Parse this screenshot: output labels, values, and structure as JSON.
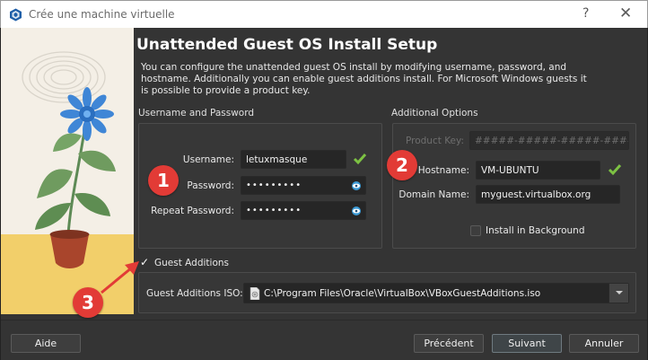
{
  "window": {
    "title": "Crée une machine virtuelle",
    "help": "?",
    "close": "✕"
  },
  "page": {
    "heading": "Unattended Guest OS Install Setup",
    "description": "You can configure the unattended guest OS install by modifying username, password, and hostname. Additionally you can enable guest additions install. For Microsoft Windows guests it is possible to provide a product key."
  },
  "user_section": {
    "title": "Username and Password",
    "username_label": "Username:",
    "username_value": "letuxmasque",
    "password_label": "Password:",
    "password_value": "•••••••••",
    "repeat_label": "Repeat Password:",
    "repeat_value": "•••••••••"
  },
  "options_section": {
    "title": "Additional Options",
    "product_key_label": "Product Key:",
    "product_key_value": "#####-#####-#####-#####",
    "hostname_label": "Hostname:",
    "hostname_value": "VM-UBUNTU",
    "domain_label": "Domain Name:",
    "domain_value": "myguest.virtualbox.org",
    "install_bg_label": "Install in Background"
  },
  "guest_additions": {
    "checkbox_label": "Guest Additions",
    "iso_label": "Guest Additions ISO:",
    "iso_value": "C:\\Program Files\\Oracle\\VirtualBox\\VBoxGuestAdditions.iso"
  },
  "annotations": {
    "badge1": "1",
    "badge2": "2",
    "badge3": "3"
  },
  "buttons": {
    "help": "Aide",
    "previous": "Précédent",
    "next": "Suivant",
    "cancel": "Annuler"
  },
  "colors": {
    "accent_check": "#7dc243",
    "badge": "#e23b36",
    "eye_icon": "#3c9bd6"
  }
}
